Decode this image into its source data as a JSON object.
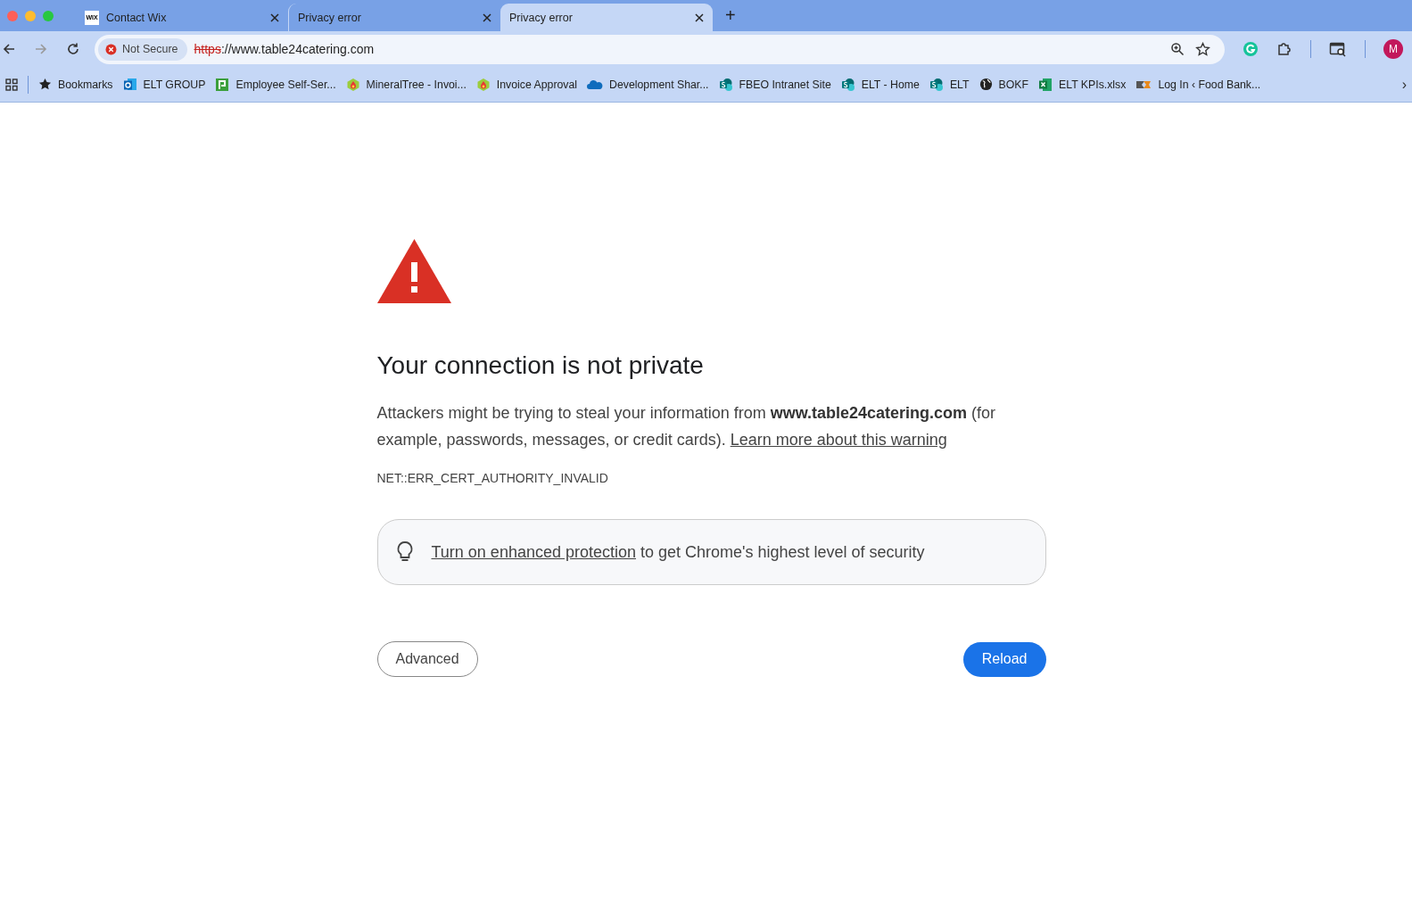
{
  "tabs": [
    {
      "title": "Contact Wix",
      "favicon_text": "WIX",
      "selected": false
    },
    {
      "title": "Privacy error",
      "selected": false
    },
    {
      "title": "Privacy error",
      "selected": true
    }
  ],
  "new_tab": "+",
  "address_bar": {
    "security_label": "Not Secure",
    "scheme": "https",
    "rest": "://www.table24catering.com"
  },
  "profile_initial": "M",
  "bookmarks": [
    {
      "kind": "star",
      "label": "Bookmarks"
    },
    {
      "kind": "outlook",
      "label": "ELT GROUP"
    },
    {
      "kind": "square",
      "label": "Employee Self-Ser..."
    },
    {
      "kind": "drop",
      "label": "MineralTree - Invoi..."
    },
    {
      "kind": "drop",
      "label": "Invoice Approval"
    },
    {
      "kind": "cloud",
      "label": "Development Shar..."
    },
    {
      "kind": "sharepoint",
      "label": "FBEO Intranet Site"
    },
    {
      "kind": "sharepoint",
      "label": "ELT - Home"
    },
    {
      "kind": "sharepoint",
      "label": "ELT"
    },
    {
      "kind": "globe",
      "label": "BOKF"
    },
    {
      "kind": "excel",
      "label": "ELT KPIs.xlsx"
    },
    {
      "kind": "flag",
      "label": "Log In ‹ Food Bank..."
    }
  ],
  "bookmarks_more": "›",
  "page": {
    "heading": "Your connection is not private",
    "message": "Attackers might be trying to steal your information from **www.table24catering.com** (for example, passwords, messages, or credit cards).",
    "learn_more": "Learn more about this warning",
    "error_code": "NET::ERR_CERT_AUTHORITY_INVALID",
    "protection_link": "Turn on enhanced protection",
    "protection_text": "to get Chrome's highest level of security",
    "buttons": [
      {
        "kind": "secondary",
        "label": "Advanced"
      },
      {
        "kind": "primary",
        "label": "Reload"
      }
    ]
  }
}
